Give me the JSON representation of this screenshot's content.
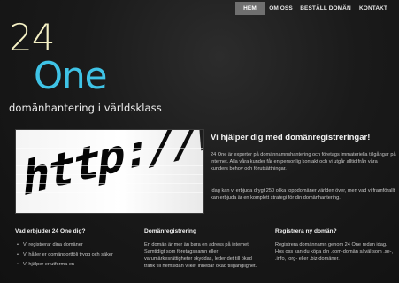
{
  "nav": {
    "items": [
      {
        "label": "HEM",
        "active": true
      },
      {
        "label": "OM OSS",
        "active": false
      },
      {
        "label": "BESTÄLL DOMÄN",
        "active": false
      },
      {
        "label": "KONTAKT",
        "active": false
      }
    ]
  },
  "logo": {
    "line1": "24",
    "line2": "One",
    "tagline": "domänhantering i världsklass",
    "colors": {
      "line1": "#f4f0c4",
      "line2": "#3fc3e6"
    }
  },
  "hero": {
    "text": "http://www."
  },
  "intro": {
    "title": "Vi hjälper dig med domänregistreringar!",
    "p1": "24 One är experter på domännamnshantering och företags immateriella tillgångar på internet. Alla våra kunder får en personlig kontakt och vi utgår alltid från våra kunders behov och förutsättningar.",
    "p2": "Idag kan vi erbjuda drygt 250 olika toppdomäner världen över, men vad vi framförallt kan erbjuda är en komplett strategi för din domänhantering."
  },
  "columns": [
    {
      "title": "Vad erbjuder 24 One dig?",
      "bullets": [
        "Vi registrerar dina domäner",
        "Vi håller er domänportfölj trygg och säker",
        "Vi hjälper er utforma en"
      ]
    },
    {
      "title": "Domänregistrering",
      "text": "En domän är mer än bara en adress på internet. Samtidigt som företagsnamn eller varumärkesrättigheter skyddas, leder det till ökad trafik till hemsidan vilket innebär ökad tillgänglighet."
    },
    {
      "title": "Registrera ny domän?",
      "text": "Registrera domännamn genom 24 One redan idag. Hos oss kan du köpa din .com-domän såväl som .se-, .info, .org- eller .biz-domäner."
    }
  ]
}
